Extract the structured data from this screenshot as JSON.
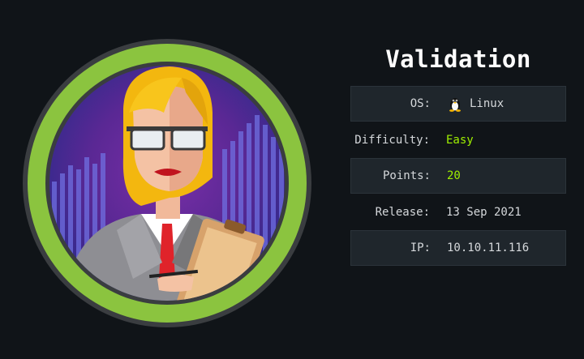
{
  "machine": {
    "name": "Validation",
    "rows": [
      {
        "label": "OS:",
        "value": "Linux",
        "icon": "linux-tux-icon",
        "accent": false
      },
      {
        "label": "Difficulty:",
        "value": "Easy",
        "accent": true
      },
      {
        "label": "Points:",
        "value": "20",
        "accent": true
      },
      {
        "label": "Release:",
        "value": "13 Sep 2021",
        "accent": false
      },
      {
        "label": "IP:",
        "value": "10.10.11.116",
        "accent": false
      }
    ]
  },
  "colors": {
    "background": "#101418",
    "row_shade": "#1f262c",
    "accent_green": "#9fef00",
    "ring_green": "#8bc43f",
    "text": "#d5d8db"
  }
}
